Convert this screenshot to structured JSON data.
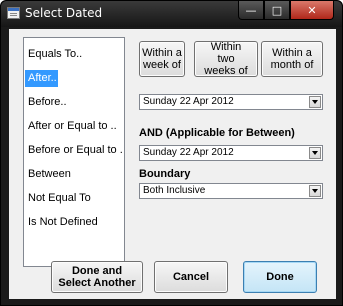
{
  "window": {
    "title": "Select Dated"
  },
  "caption": {
    "minimize": "—",
    "maximize": "□",
    "close": "✕"
  },
  "conditions": [
    {
      "label": "Equals To.."
    },
    {
      "label": "After.."
    },
    {
      "label": "Before.."
    },
    {
      "label": "After or Equal to .."
    },
    {
      "label": "Before or Equal to ..."
    },
    {
      "label": "Between"
    },
    {
      "label": "Not Equal To"
    },
    {
      "label": "Is Not Defined"
    }
  ],
  "selected_condition": "After..",
  "quick": {
    "week": "Within a week of",
    "two_weeks": "Within two weeks of",
    "month": "Within a month of"
  },
  "date1": {
    "value": "Sunday 22 Apr 2012"
  },
  "between_label": "AND (Applicable for Between)",
  "date2": {
    "value": "Sunday 22 Apr 2012"
  },
  "boundary_label": "Boundary",
  "boundary": {
    "value": "Both Inclusive"
  },
  "footer": {
    "done_select": "Done and Select Another",
    "cancel": "Cancel",
    "done": "Done"
  }
}
